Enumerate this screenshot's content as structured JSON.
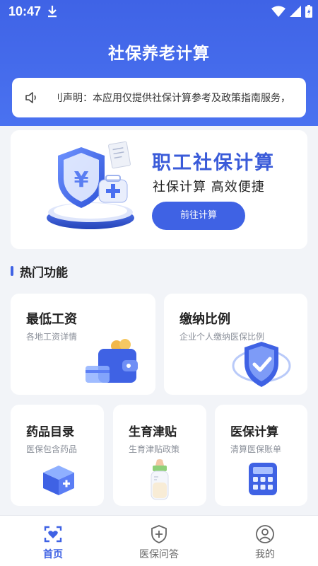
{
  "status_bar": {
    "time": "10:47"
  },
  "app": {
    "title": "社保养老计算"
  },
  "notice": {
    "text": "刂声明：本应用仅提供社保计算参考及政策指南服务，"
  },
  "hero": {
    "title": "职工社保计算",
    "subtitle": "社保计算 高效便捷",
    "button_label": "前往计算"
  },
  "section": {
    "title": "热门功能"
  },
  "features": [
    {
      "title": "最低工资",
      "subtitle": "各地工资详情"
    },
    {
      "title": "缴纳比例",
      "subtitle": "企业个人缴纳医保比例"
    },
    {
      "title": "药品目录",
      "subtitle": "医保包含药品"
    },
    {
      "title": "生育津贴",
      "subtitle": "生育津贴政策"
    },
    {
      "title": "医保计算",
      "subtitle": "清算医保账单"
    }
  ],
  "tabs": [
    {
      "label": "首页",
      "icon": "home-heart-icon",
      "active": true
    },
    {
      "label": "医保问答",
      "icon": "shield-plus-icon",
      "active": false
    },
    {
      "label": "我的",
      "icon": "user-icon",
      "active": false
    }
  ],
  "colors": {
    "primary": "#3f62e4",
    "background": "#f2f4f8",
    "card": "#ffffff"
  }
}
